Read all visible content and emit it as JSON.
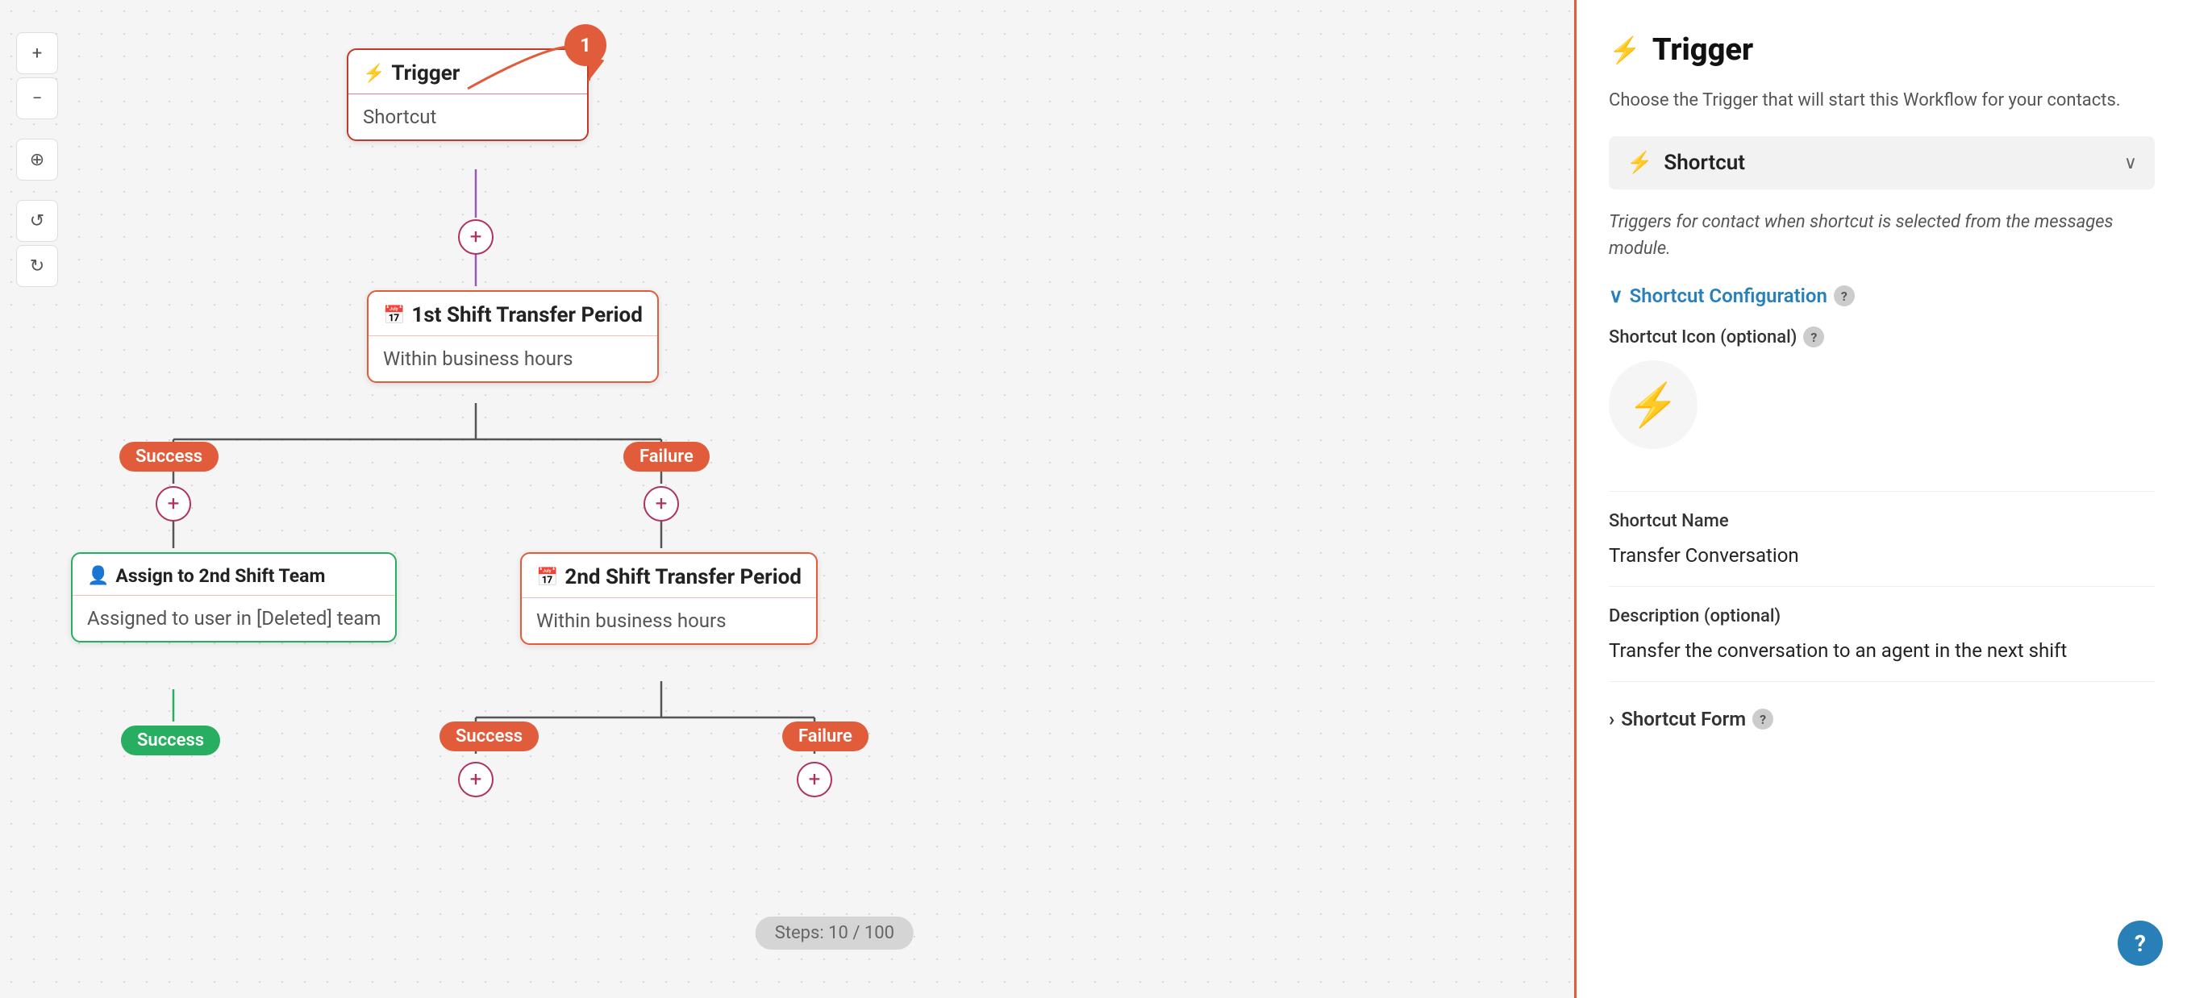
{
  "canvas": {
    "toolbar": {
      "zoom_in": "+",
      "zoom_out": "−",
      "crosshair": "⊕",
      "undo": "↺",
      "redo": "↻"
    },
    "nodes": {
      "trigger": {
        "label": "Trigger",
        "value": "Shortcut",
        "step_number": "1"
      },
      "shift1": {
        "label": "1st Shift Transfer Period",
        "value": "Within business hours"
      },
      "assign": {
        "label": "Assign to 2nd Shift Team",
        "value": "Assigned to user in [Deleted] team"
      },
      "shift2": {
        "label": "2nd Shift Transfer Period",
        "value": "Within business hours"
      }
    },
    "badges": {
      "success1": "Success",
      "failure1": "Failure",
      "success2": "Success",
      "failure2": "Failure",
      "success3": "Success"
    },
    "steps_counter": "Steps: 10 / 100"
  },
  "panel": {
    "title": "Trigger",
    "subtitle": "Choose the Trigger that will start this Workflow for your contacts.",
    "selector": {
      "icon_label": "⚡",
      "label": "Shortcut"
    },
    "description": "Triggers for contact when shortcut is selected from the messages module.",
    "config_section": {
      "label": "Shortcut Configuration",
      "help_title": "?"
    },
    "icon_field": {
      "label": "Shortcut Icon (optional)",
      "help_title": "?",
      "icon": "⚡"
    },
    "name_field": {
      "label": "Shortcut Name",
      "value": "Transfer Conversation"
    },
    "description_field": {
      "label": "Description (optional)",
      "value": "Transfer the conversation to an agent in the next shift"
    },
    "form_section": {
      "label": "Shortcut Form",
      "help_title": "?"
    },
    "help_btn": "?"
  }
}
